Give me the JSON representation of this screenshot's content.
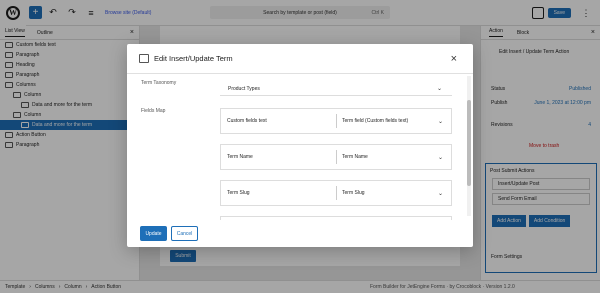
{
  "colors": {
    "accent": "#1e6fb8",
    "danger": "#cc1818",
    "overlay": "rgba(0,0,0,0.35)"
  },
  "topbar": {
    "logo": "W",
    "add_icon": "+",
    "undo_icon": "↶",
    "redo_icon": "↷",
    "listview_icon": "≡",
    "link_text": "Browse site (Default)",
    "command_text": "Search by template or post (field)",
    "command_key": "Ctrl K",
    "view_icon": "☐",
    "save_label": "Save",
    "settings_icon": "⋮"
  },
  "left_panel": {
    "tabs": [
      "List View",
      "Outline"
    ],
    "close_icon": "×",
    "items": [
      {
        "label": "Custom fields text",
        "indent": 0,
        "selected": false
      },
      {
        "label": "Paragraph",
        "indent": 0,
        "selected": false
      },
      {
        "label": "Heading",
        "indent": 0,
        "selected": false
      },
      {
        "label": "Paragraph",
        "indent": 0,
        "selected": false
      },
      {
        "label": "Columns",
        "indent": 0,
        "selected": false
      },
      {
        "label": "Column",
        "indent": 1,
        "selected": false
      },
      {
        "label": "Data and more for the term",
        "indent": 2,
        "selected": false
      },
      {
        "label": "Column",
        "indent": 1,
        "selected": false
      },
      {
        "label": "Data and more for the term",
        "indent": 2,
        "selected": true
      },
      {
        "label": "Action Button",
        "indent": 0,
        "selected": false
      },
      {
        "label": "Paragraph",
        "indent": 0,
        "selected": false
      }
    ]
  },
  "canvas": {
    "button_label": "Submit"
  },
  "right_panel": {
    "tabs": [
      "Action",
      "Block"
    ],
    "close_icon": "×",
    "title": "Edit Insert / Update Term Action",
    "rows": [
      {
        "label": "Status",
        "value": "Published"
      },
      {
        "label": "Publish",
        "value": "June 1, 2023 at 12:00 pm"
      },
      {
        "label": "Revisions",
        "value": "4"
      }
    ],
    "trash_label": "Move to trash",
    "box_title": "Post Submit Actions",
    "actions": [
      "Insert/Update Post",
      "Send Form Email"
    ],
    "btn_add": "Add Action",
    "btn_settings": "Add Condition",
    "footer_label": "Form Settings"
  },
  "statusbar": {
    "crumbs": [
      "Template",
      "Columns",
      "Column",
      "Action Button"
    ],
    "tail": "Form Builder for JetEngine Forms · by Crocoblock · Version 1.2.0"
  },
  "modal": {
    "title": "Edit Insert/Update Term",
    "close_icon": "×",
    "field_label": "Term Taxonomy",
    "select_value": "Product Types",
    "map_label": "Fields Map",
    "pairs": [
      {
        "left": "Custom fields text",
        "right": "Term field (Custom fields text)"
      },
      {
        "left": "Term Name",
        "right": "Term Name"
      },
      {
        "left": "Term Slug",
        "right": "Term Slug"
      }
    ],
    "chev": "⌄",
    "apply": "Update",
    "cancel": "Cancel"
  }
}
